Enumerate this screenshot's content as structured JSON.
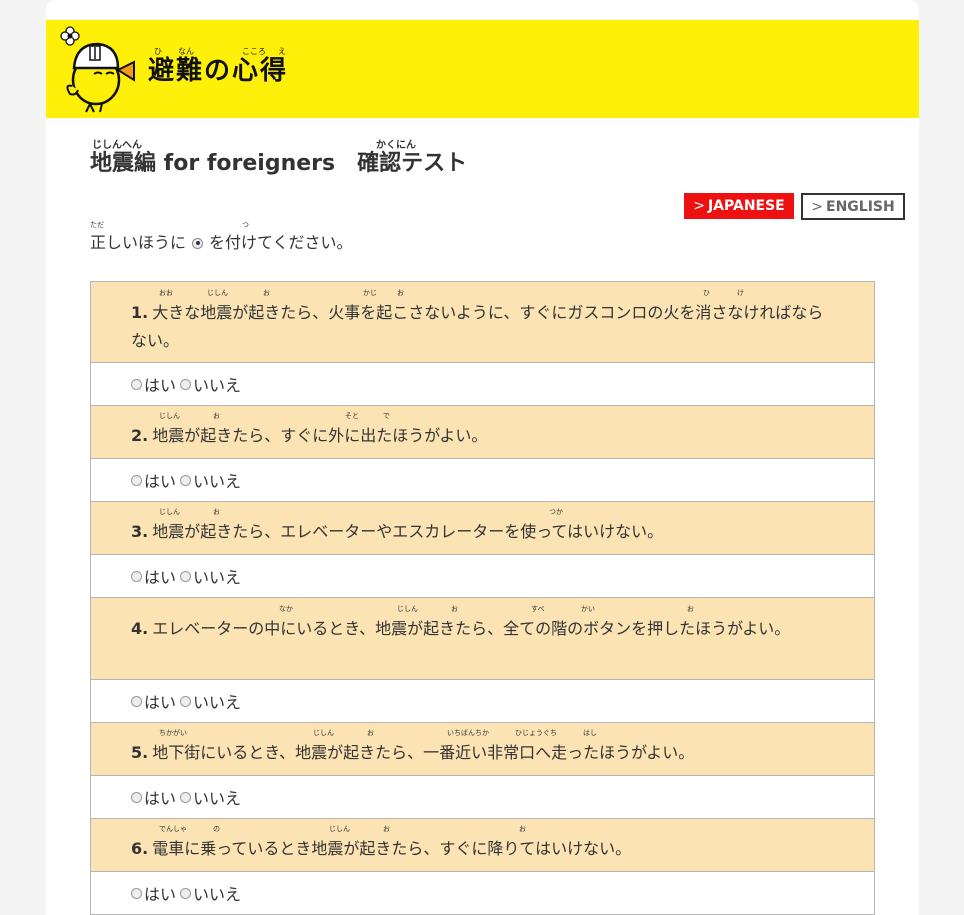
{
  "logo": {
    "text": "避難の心得",
    "ruby": [
      "ひ",
      "なん",
      "こころ",
      "え"
    ]
  },
  "title": {
    "part1": "地震編 for foreigners",
    "part1_ruby": "じしんへん",
    "part2": "確認テスト",
    "part2_ruby": "かくにん"
  },
  "lang": {
    "arrow": ">",
    "japanese": "JAPANESE",
    "english": "ENGLISH"
  },
  "instruction": {
    "before": "正しいほうに",
    "after": "を付けてください。",
    "ruby_tada": "ただ",
    "ruby_tsu": "つ"
  },
  "options": {
    "yes": "はい",
    "no": "いいえ"
  },
  "questions": [
    {
      "number": "1.",
      "text": "大きな地震が起きたら、火事を起こさないように、すぐにガスコンロの火を消さなければならない。",
      "ruby": [
        "おお",
        "じしん",
        "お",
        "かじ",
        "お",
        "ひ",
        "け"
      ]
    },
    {
      "number": "2.",
      "text": "地震が起きたら、すぐに外に出たほうがよい。",
      "ruby": [
        "じしん",
        "お",
        "そと",
        "で"
      ]
    },
    {
      "number": "3.",
      "text": "地震が起きたら、エレベーターやエスカレーターを使ってはいけない。",
      "ruby": [
        "じしん",
        "お",
        "つか"
      ]
    },
    {
      "number": "4.",
      "text": "エレベーターの中にいるとき、地震が起きたら、全ての階のボタンを押したほうがよい。",
      "ruby": [
        "なか",
        "じしん",
        "お",
        "すべ",
        "かい",
        "お"
      ]
    },
    {
      "number": "5.",
      "text": "地下街にいるとき、地震が起きたら、一番近い非常口へ走ったほうがよい。",
      "ruby": [
        "ちかがい",
        "じしん",
        "お",
        "いちばんちか",
        "ひじょうぐち",
        "はし"
      ]
    },
    {
      "number": "6.",
      "text": "電車に乗っているとき地震が起きたら、すぐに降りてはいけない。",
      "ruby": [
        "でんしゃ",
        "の",
        "じしん",
        "お",
        "お"
      ]
    }
  ],
  "colors": {
    "header_bg": "#fff00a",
    "question_bg": "#fbe3b4",
    "japanese_button": "#ee1111"
  }
}
